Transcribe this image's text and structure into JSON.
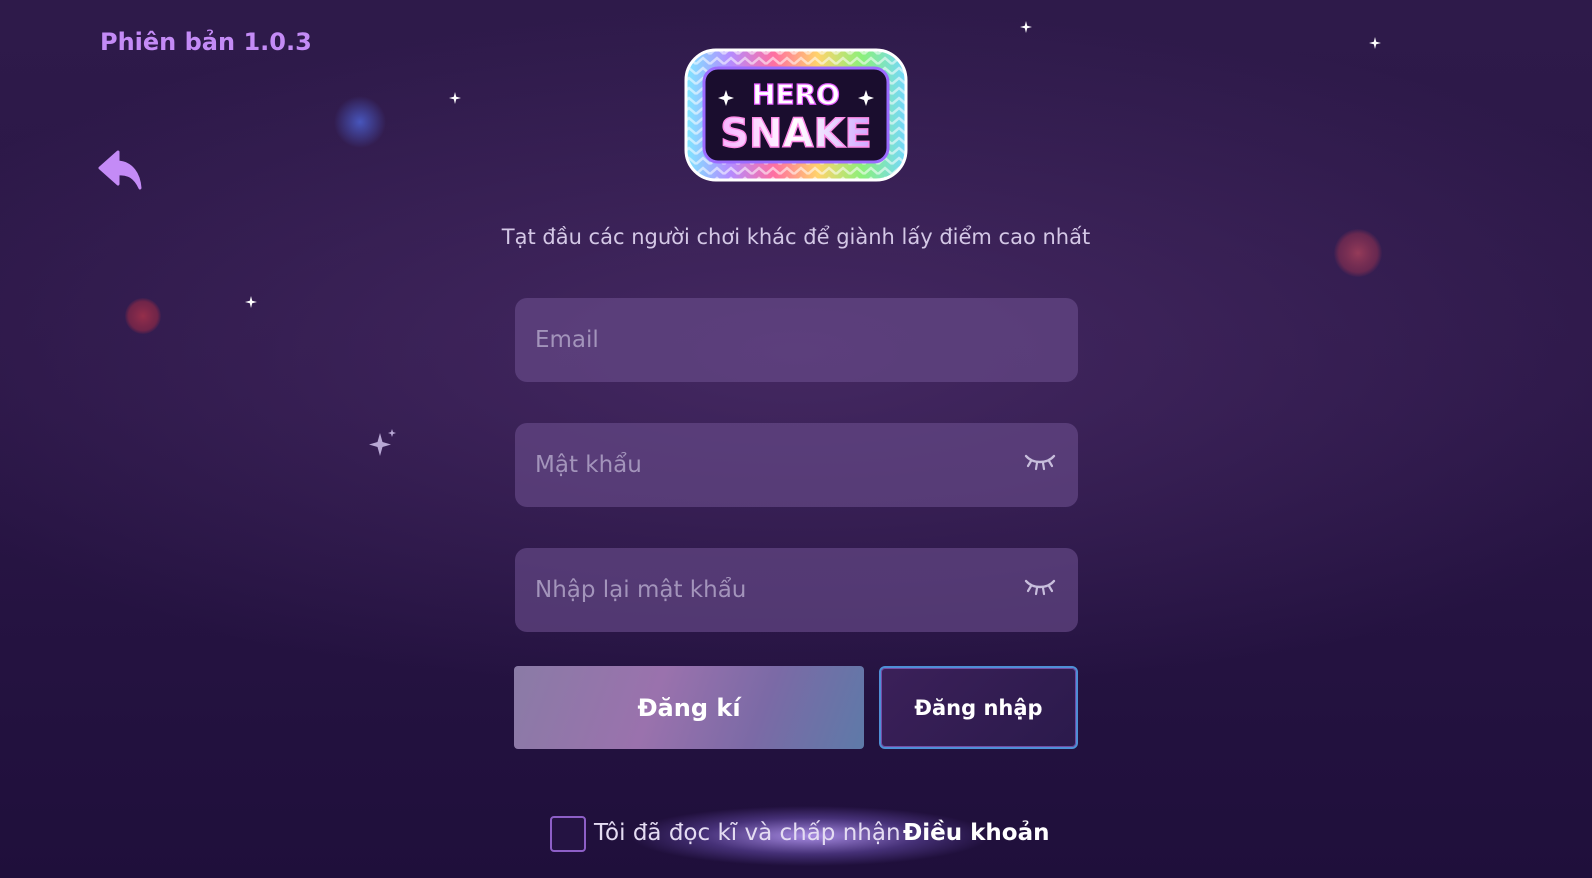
{
  "app": {
    "version_label": "Phiên bản 1.0.3",
    "logo_text": {
      "line1": "HERO",
      "line2": "SNAKE"
    }
  },
  "tagline": "Tạt đầu các người chơi khác để giành lấy điểm cao nhất",
  "form": {
    "email_placeholder": "Email",
    "password_placeholder": "Mật khẩu",
    "confirm_password_placeholder": "Nhập lại mật khẩu"
  },
  "buttons": {
    "register_label": "Đăng kí",
    "login_label": "Đăng nhập"
  },
  "terms": {
    "text": "Tôi đã đọc kĩ và chấp nhận",
    "link": "Điều khoản",
    "checked": false
  },
  "icons": {
    "back": "back-arrow-icon",
    "eye_hidden": "eye-closed-icon",
    "sparkle": "sparkle-icon"
  },
  "colors": {
    "accent": "#c48bf6",
    "field_bg": "#6a4e8c",
    "login_border": "#4e8fd6"
  }
}
